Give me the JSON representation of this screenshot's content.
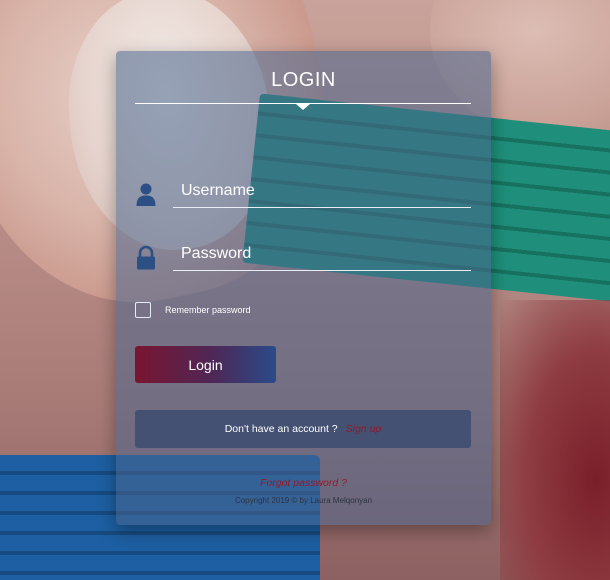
{
  "login": {
    "title": "LOGIN",
    "username": {
      "placeholder": "Username",
      "value": "",
      "icon": "user-icon"
    },
    "password": {
      "placeholder": "Password",
      "value": "",
      "icon": "lock-icon"
    },
    "remember_label": "Remember password",
    "remember_checked": false,
    "login_button_label": "Login",
    "signup_prompt": "Don't have an account ?",
    "signup_link": "Sign up",
    "forgot_password": "Forgot password ?",
    "copyright": "Copyright 2019 © by Laura Melqonyan"
  },
  "colors": {
    "card_bg": "#48648C",
    "button_start": "#7A1530",
    "button_end": "#2A4B8A",
    "link": "#8F1B2C",
    "icon": "#2C4F86"
  }
}
